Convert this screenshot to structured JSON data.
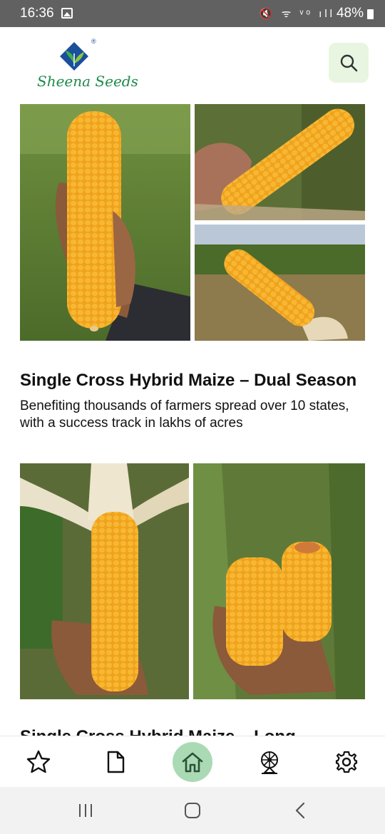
{
  "status_bar": {
    "time": "16:36",
    "icons_text": "🔇 ᯤ ᵛᵒ ıll",
    "battery": "48%"
  },
  "header": {
    "logo_text": "Sheena Seeds",
    "logo_registered": "®"
  },
  "icons": {
    "search": "search-icon",
    "favorites": "star-icon",
    "documents": "document-icon",
    "home": "home-icon",
    "wheel": "wheel-icon",
    "settings": "gear-icon",
    "recents": "recents-icon",
    "sys_home": "system-home-icon",
    "back": "back-icon"
  },
  "colors": {
    "accent": "#1f8a4c",
    "logo_blue": "#1a4f9c",
    "search_bg": "#e8f5e1",
    "nav_active_bg": "#a9dab4",
    "status_bar": "#616161"
  },
  "products": [
    {
      "title": "Single Cross Hybrid Maize – Dual Season",
      "description": "Benefiting thousands of farmers spread over 10 states, with a success track in lakhs of acres"
    },
    {
      "title": "Single Cross Hybrid Maize – Long"
    }
  ],
  "bottom_nav": {
    "active": "home"
  }
}
